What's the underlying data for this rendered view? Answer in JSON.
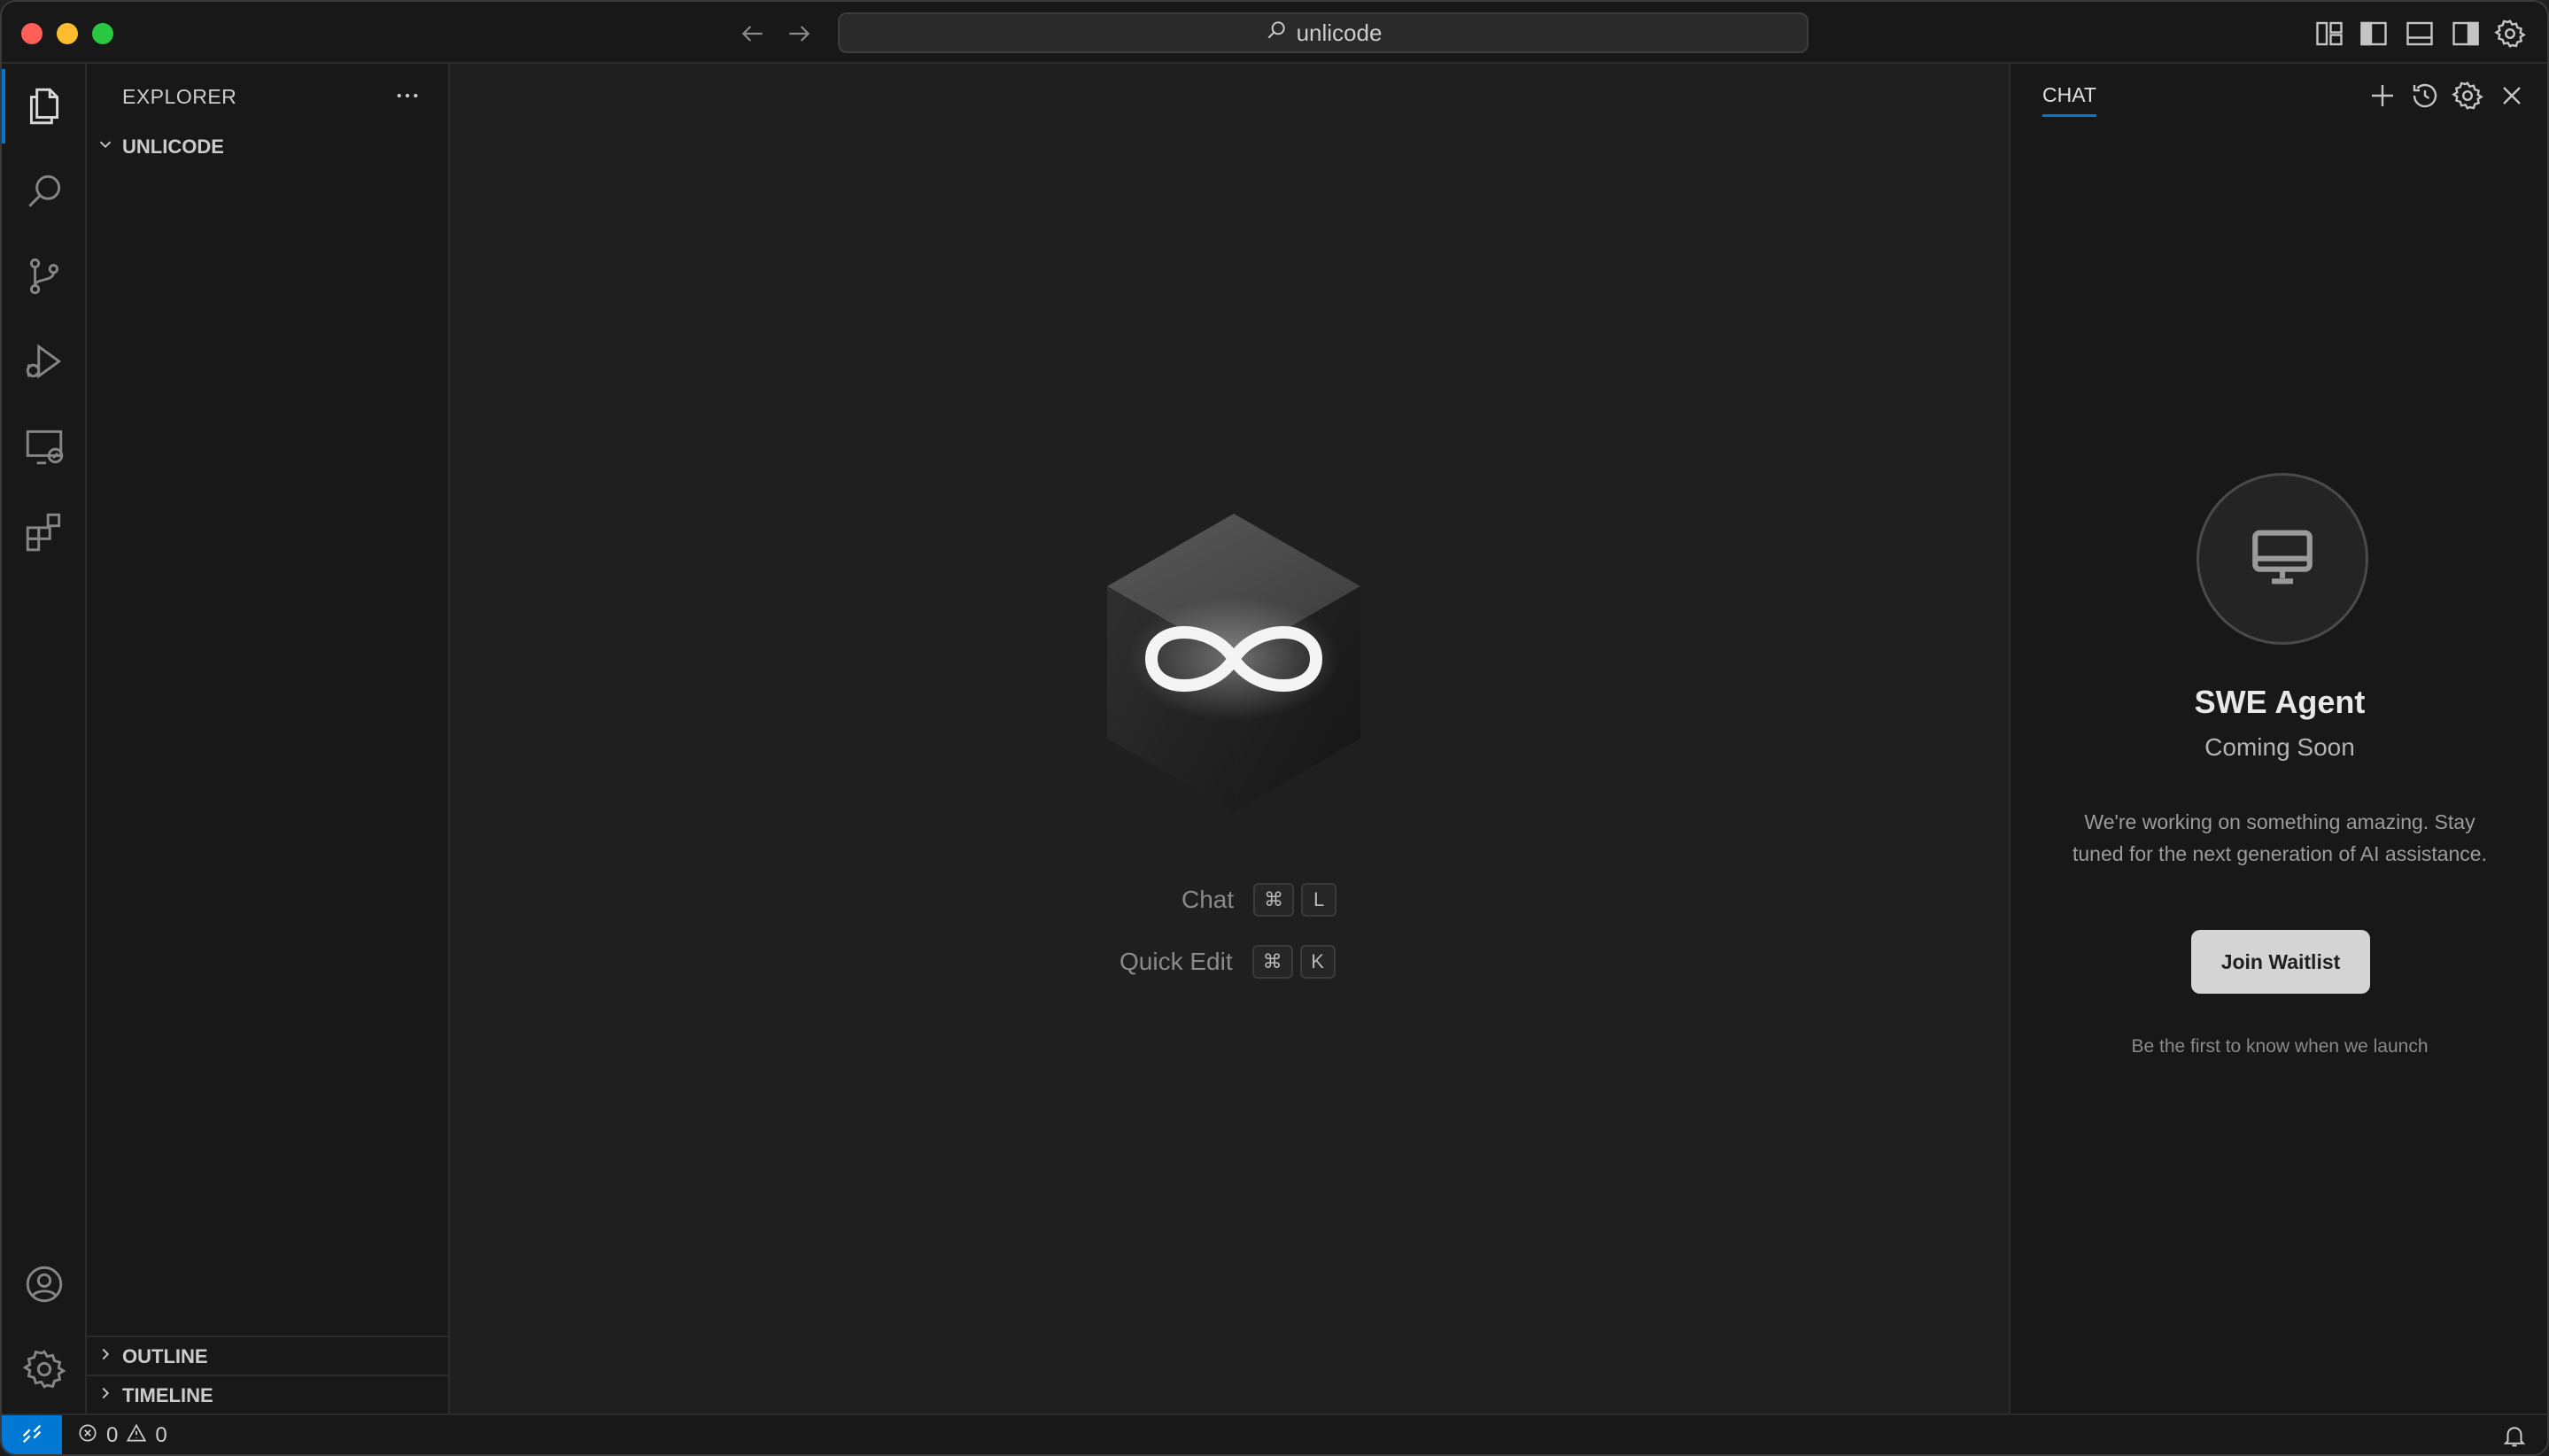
{
  "window": {
    "search_text": "unlicode"
  },
  "sidebar": {
    "title": "EXPLORER",
    "root_folder": "UNLICODE",
    "sections": [
      {
        "label": "OUTLINE"
      },
      {
        "label": "TIMELINE"
      }
    ]
  },
  "activity_bar": {
    "items": [
      "files-icon",
      "search-icon",
      "source-control-icon",
      "run-debug-icon",
      "remote-explorer-icon",
      "extensions-icon"
    ],
    "bottom_items": [
      "account-icon",
      "manage-gear-icon"
    ]
  },
  "editor": {
    "shortcuts": [
      {
        "label": "Chat",
        "keys": [
          "⌘",
          "L"
        ]
      },
      {
        "label": "Quick Edit",
        "keys": [
          "⌘",
          "K"
        ]
      }
    ]
  },
  "chat": {
    "tab_label": "CHAT",
    "agent_title": "SWE Agent",
    "agent_subtitle": "Coming Soon",
    "description": "We're working on something amazing. Stay tuned for the next generation of AI assistance.",
    "button_label": "Join Waitlist",
    "note": "Be the first to know when we launch"
  },
  "statusbar": {
    "errors": "0",
    "warnings": "0"
  },
  "colors": {
    "accent": "#0078d4",
    "background": "#1f1f1f",
    "sidebar_bg": "#181818"
  }
}
